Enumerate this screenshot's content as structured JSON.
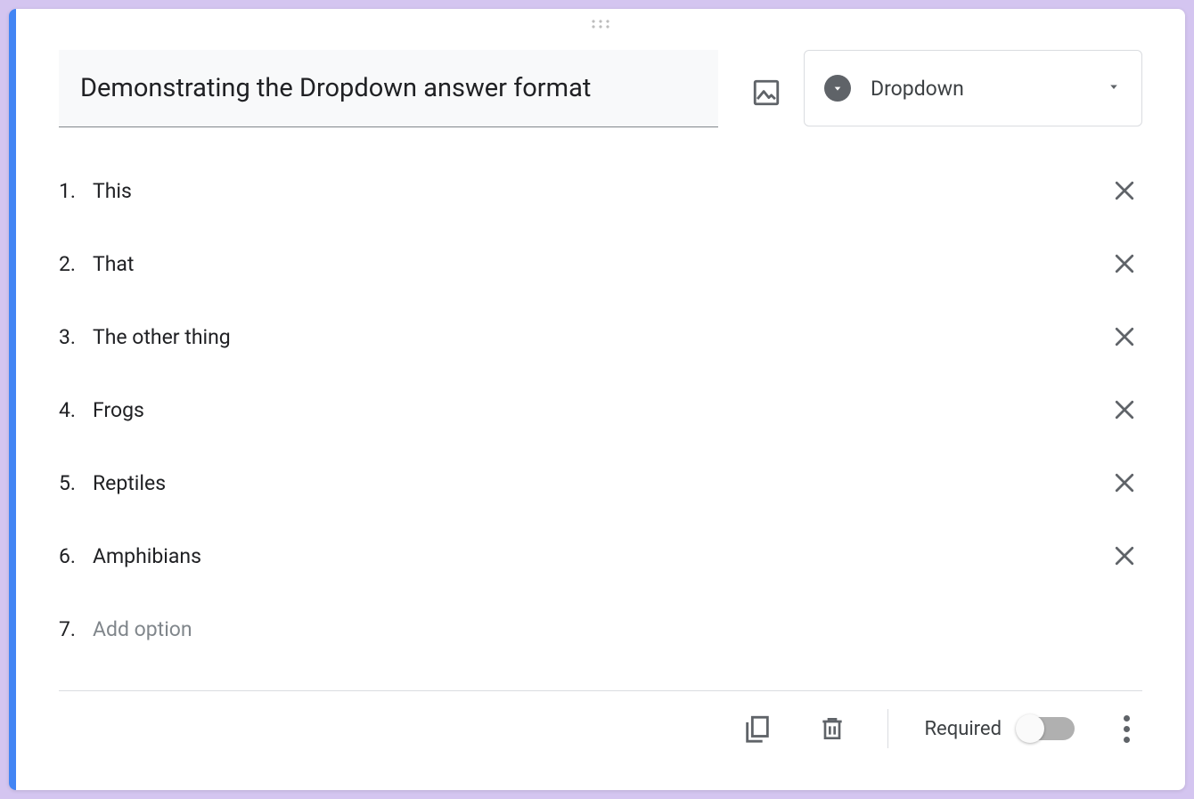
{
  "question": {
    "title": "Demonstrating the Dropdown answer format"
  },
  "type_select": {
    "label": "Dropdown"
  },
  "options": [
    {
      "num": "1.",
      "text": "This"
    },
    {
      "num": "2.",
      "text": "That"
    },
    {
      "num": "3.",
      "text": "The other thing"
    },
    {
      "num": "4.",
      "text": "Frogs"
    },
    {
      "num": "5.",
      "text": "Reptiles"
    },
    {
      "num": "6.",
      "text": "Amphibians"
    }
  ],
  "add_option": {
    "num": "7.",
    "placeholder": "Add option"
  },
  "footer": {
    "required_label": "Required"
  }
}
